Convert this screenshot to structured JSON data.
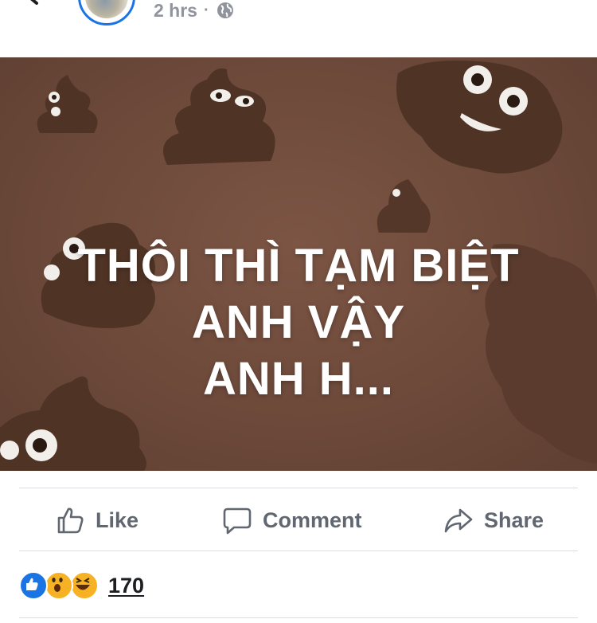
{
  "post": {
    "time": "2 hrs",
    "separator": "·",
    "privacy_icon": "globe-icon",
    "image_text": {
      "line1": "THÔI THÌ TẠM BIỆT",
      "line2": "ANH VẬY",
      "line3": "ANH H..."
    }
  },
  "actions": {
    "like": "Like",
    "comment": "Comment",
    "share": "Share"
  },
  "reactions": {
    "types": [
      "like",
      "wow",
      "haha"
    ],
    "count": "170"
  },
  "colors": {
    "image_background": "#6b4839",
    "poop": "#5a3a2c",
    "accent": "#1b74e4",
    "action_text": "#606770"
  }
}
